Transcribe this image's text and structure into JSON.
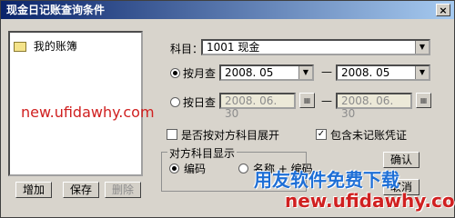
{
  "window": {
    "title": "现金日记账查询条件",
    "close_glyph": "×"
  },
  "tree": {
    "root_label": "我的账簿"
  },
  "left_buttons": {
    "add": "增加",
    "save": "保存",
    "delete": "删除"
  },
  "subject": {
    "label": "科目：",
    "value": "1001  现金"
  },
  "by_month": {
    "label": "按月查",
    "from": "2008. 05",
    "to": "2008. 05",
    "dash": "—",
    "selected": true
  },
  "by_day": {
    "label": "按日查",
    "from": "2008. 06. 30",
    "to": "2008. 06. 30",
    "dash": "—",
    "selected": false
  },
  "options": {
    "expand_counter": {
      "label": "是否按对方科目展开",
      "checked": false
    },
    "include_unposted": {
      "label": "包含未记账凭证",
      "checked": true
    }
  },
  "counter_display": {
    "caption": "对方科目显示",
    "code_label": "编码",
    "name_code_label": "名称 + 编码"
  },
  "actions": {
    "ok": "确认",
    "cancel": "取消"
  },
  "watermarks": {
    "url_left": "new.ufidawhy.com",
    "brand": "用友软件免费下载",
    "url_right": "new.ufidawhy.com"
  },
  "colors": {
    "title_start": "#0a246a",
    "watermark_red": "#d02020",
    "watermark_blue": "#1e6fd6"
  }
}
